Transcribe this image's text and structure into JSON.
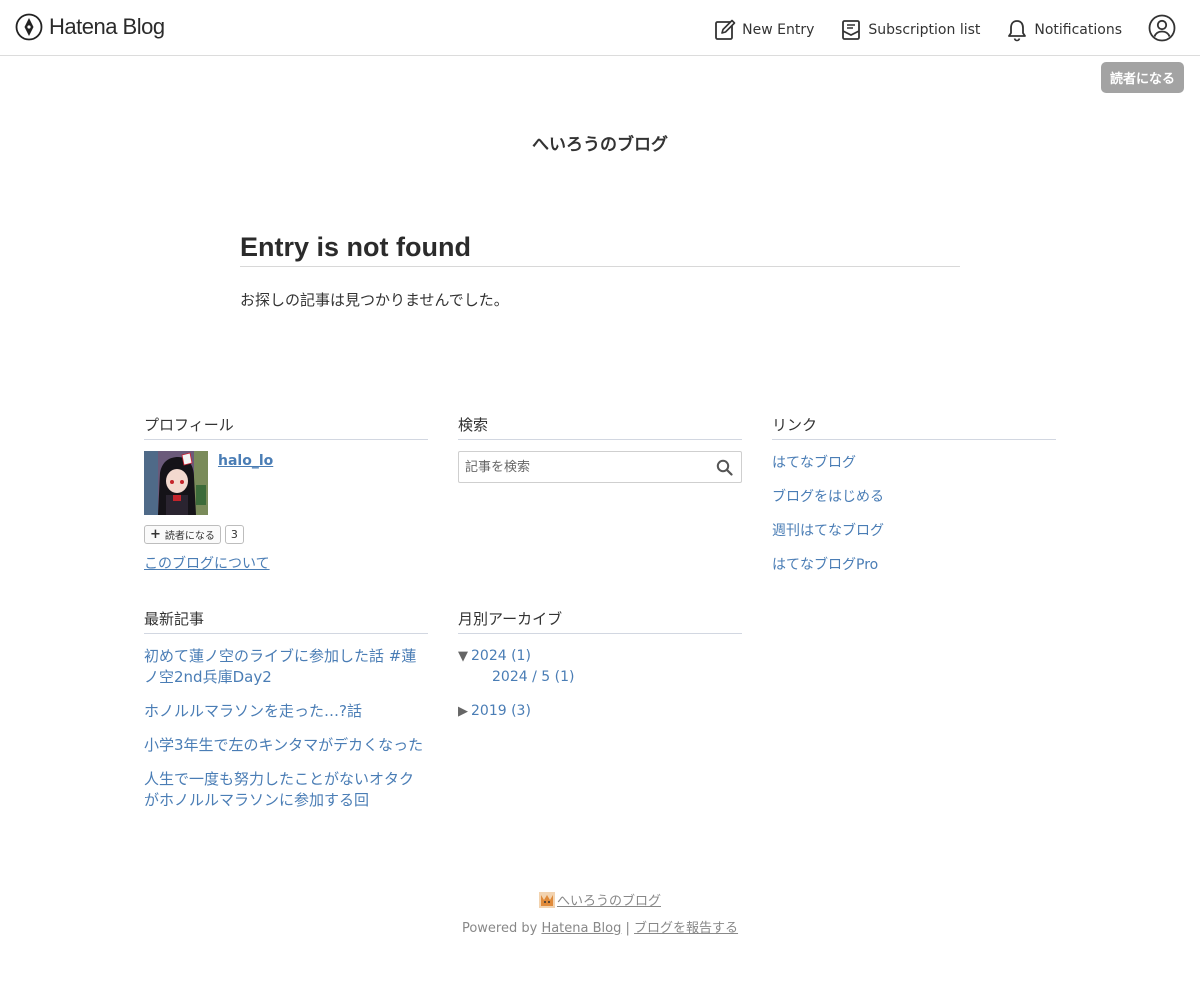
{
  "header": {
    "logo_text": "Hatena Blog",
    "new_entry": "New Entry",
    "subscription_list": "Subscription list",
    "notifications": "Notifications"
  },
  "follow_button": "読者になる",
  "blog_title": "へいろうのブログ",
  "main": {
    "heading": "Entry is not found",
    "message": "お探しの記事は見つかりませんでした。"
  },
  "profile": {
    "title": "プロフィール",
    "username": "halo_lo",
    "reader_button": "読者になる",
    "reader_count": "3",
    "about_link": "このブログについて"
  },
  "search": {
    "title": "検索",
    "placeholder": "記事を検索"
  },
  "links": {
    "title": "リンク",
    "items": [
      "はてなブログ",
      "ブログをはじめる",
      "週刊はてなブログ",
      "はてなブログPro"
    ]
  },
  "recent": {
    "title": "最新記事",
    "items": [
      "初めて蓮ノ空のライブに参加した話 #蓮ノ空2nd兵庫Day2",
      "ホノルルマラソンを走った…?話",
      "小学3年生で左のキンタマがデカくなった",
      "人生で一度も努力したことがないオタクがホノルルマラソンに参加する回"
    ]
  },
  "archive": {
    "title": "月別アーカイブ",
    "year_2024": "2024 (1)",
    "month_2024_5": "2024 / 5 (1)",
    "year_2019": "2019 (3)",
    "expanded_arrow": "▼",
    "collapsed_arrow": "▶"
  },
  "footer": {
    "blog_link": "へいろうのブログ",
    "powered_by": "Powered by",
    "hatena_blog": "Hatena Blog",
    "separator": "|",
    "report": "ブログを報告する"
  },
  "colors": {
    "link": "#4a7db5",
    "follow_button_bg": "#a3a3a3",
    "module_border": "#d2d7e1"
  }
}
